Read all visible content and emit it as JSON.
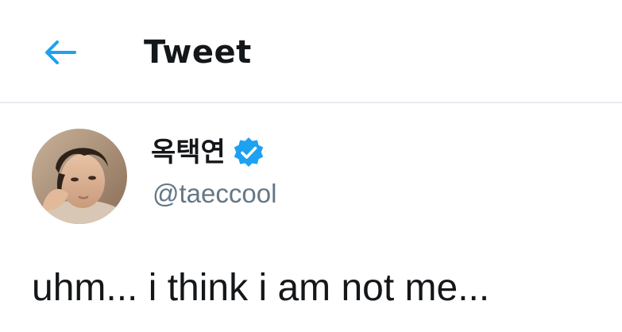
{
  "header": {
    "title": "Tweet",
    "back_icon": "back-arrow-icon"
  },
  "tweet": {
    "author": {
      "display_name": "옥택연",
      "handle": "@taeccool",
      "verified": true,
      "verified_icon": "verified-badge-icon",
      "avatar": "profile-photo"
    },
    "text": "uhm... i think i am not me..."
  },
  "colors": {
    "accent": "#1da1f2",
    "text_primary": "#14171a",
    "text_secondary": "#657786",
    "divider": "#e6ecf0"
  }
}
